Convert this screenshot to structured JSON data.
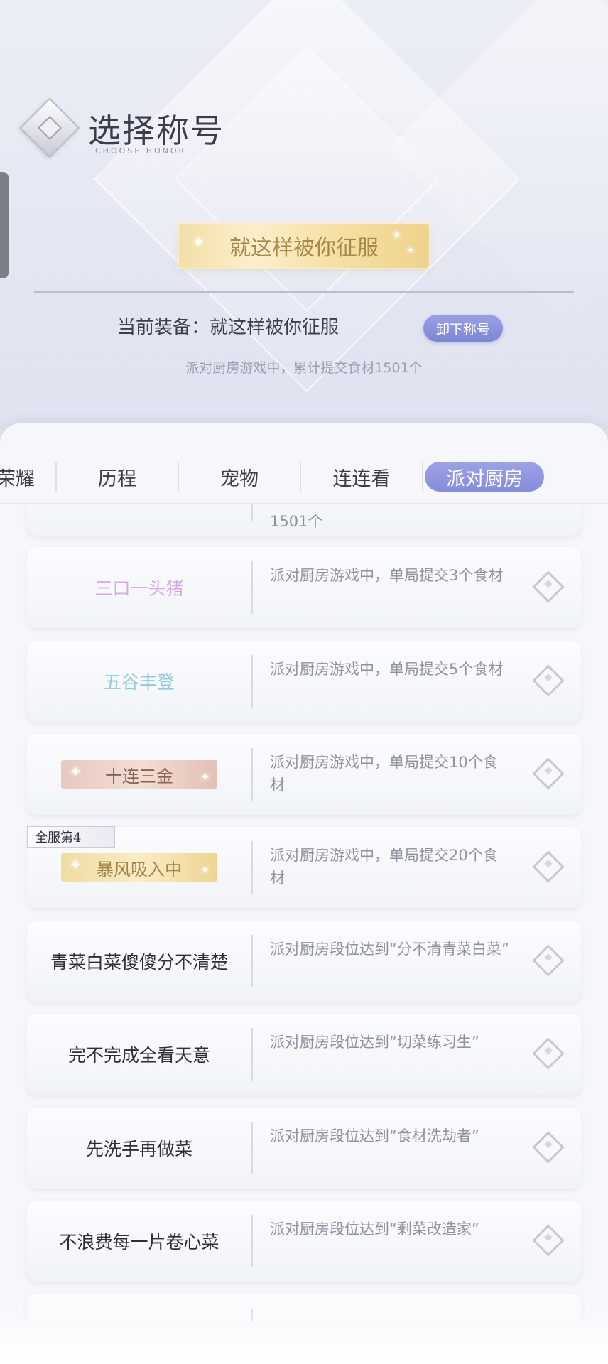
{
  "header": {
    "title": "选择称号",
    "subtitle": "CHOOSE HONOR",
    "current_honor_banner": "就这样被你征服",
    "equip_label": "当前装备：就这样被你征服",
    "unequip_button": "卸下称号",
    "equip_description": "派对厨房游戏中，累计提交食材1501个"
  },
  "tabs": [
    {
      "label": "荣耀",
      "active": false
    },
    {
      "label": "历程",
      "active": false
    },
    {
      "label": "宠物",
      "active": false
    },
    {
      "label": "连连看",
      "active": false
    },
    {
      "label": "派对厨房",
      "active": true
    }
  ],
  "list": {
    "partial_top_desc": "1501个",
    "rank_tag": "全服第4",
    "items": [
      {
        "name": "三口一头猪",
        "name_color": "#d9a9e6",
        "style": "plain",
        "desc": "派对厨房游戏中，单局提交3个食材"
      },
      {
        "name": "五谷丰登",
        "name_color": "#8fc8df",
        "style": "plain",
        "desc": "派对厨房游戏中，单局提交5个食材"
      },
      {
        "name": "十连三金",
        "name_color": "#8a6155",
        "style": "rose-badge",
        "desc": "派对厨房游戏中，单局提交10个食材"
      },
      {
        "name": "暴风吸入中",
        "name_color": "#a38447",
        "style": "gold-badge",
        "desc": "派对厨房游戏中，单局提交20个食材"
      },
      {
        "name": "青菜白菜傻傻分不清楚",
        "name_color": "#2c2e38",
        "style": "plain",
        "desc": "派对厨房段位达到“分不清青菜白菜”"
      },
      {
        "name": "完不完成全看天意",
        "name_color": "#2c2e38",
        "style": "plain",
        "desc": "派对厨房段位达到“切菜练习生”"
      },
      {
        "name": "先洗手再做菜",
        "name_color": "#2c2e38",
        "style": "plain",
        "desc": "派对厨房段位达到“食材洗劫者”"
      },
      {
        "name": "不浪费每一片卷心菜",
        "name_color": "#2c2e38",
        "style": "plain",
        "desc": "派对厨房段位达到“剩菜改造家”"
      }
    ]
  },
  "colors": {
    "accent": "#8a91dd",
    "gold": "#f3dfa8",
    "rose": "#e7c9c0"
  },
  "icons": {
    "card_action": "diamond-select-icon",
    "title_logo": "diamond-logo-icon"
  }
}
